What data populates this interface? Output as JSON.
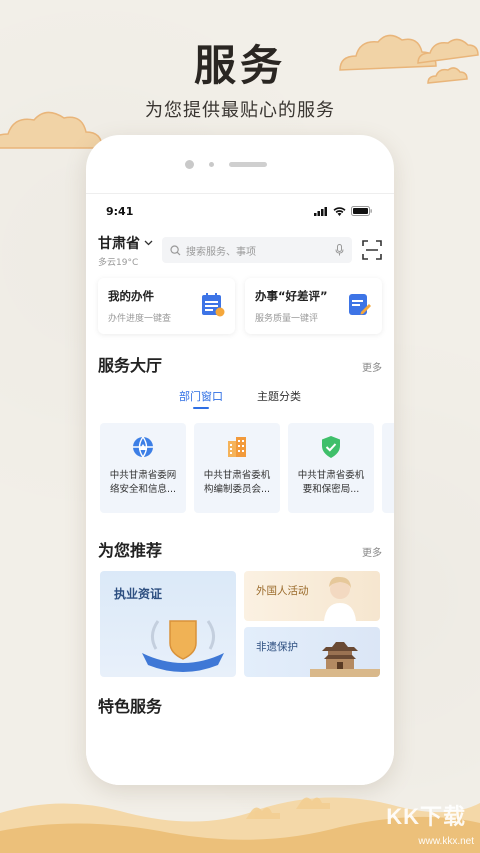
{
  "promo": {
    "title": "服务",
    "subtitle": "为您提供最贴心的服务"
  },
  "status_bar": {
    "time": "9:41",
    "icons": [
      "signal-icon",
      "wifi-icon",
      "battery-icon"
    ]
  },
  "header": {
    "location": "甘肃省",
    "weather": "多云19°C",
    "search_placeholder": "搜索服务、事项",
    "icons": [
      "search-icon",
      "microphone-icon",
      "scan-icon"
    ]
  },
  "quick_cards": [
    {
      "title": "我的办件",
      "subtitle": "办件进度一键查",
      "icon": "calendar-icon"
    },
    {
      "title": "办事“好差评”",
      "subtitle": "服务质量一键评",
      "icon": "review-icon"
    }
  ],
  "service_hall": {
    "title": "服务大厅",
    "more": "更多",
    "tabs": [
      {
        "label": "部门窗口",
        "active": true
      },
      {
        "label": "主题分类",
        "active": false
      }
    ],
    "departments": [
      {
        "name": "中共甘肃省委网络安全和信息...",
        "icon": "network-globe-icon",
        "color": "#3d7fe6"
      },
      {
        "name": "中共甘肃省委机构编制委员会...",
        "icon": "building-icon",
        "color": "#f29a3b"
      },
      {
        "name": "中共甘肃省委机要和保密局...",
        "icon": "shield-check-icon",
        "color": "#3fbf6a"
      }
    ]
  },
  "recommend": {
    "title": "为您推荐",
    "more": "更多",
    "items": [
      {
        "title": "执业资证"
      },
      {
        "title": "外国人活动"
      },
      {
        "title": "非遗保护"
      }
    ]
  },
  "featured": {
    "title": "特色服务"
  },
  "watermark": {
    "logo": "KK下载",
    "url": "www.kkx.net"
  },
  "colors": {
    "accent": "#2f6fe4",
    "background": "#f2efe8"
  }
}
